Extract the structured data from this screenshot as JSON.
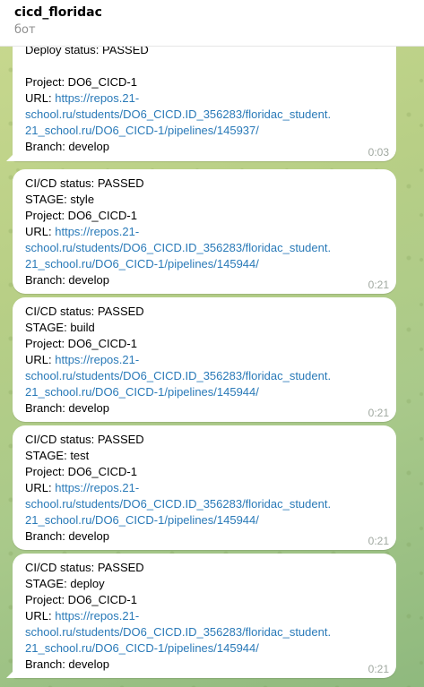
{
  "header": {
    "title": "cicd_floridac",
    "subtitle": "бот"
  },
  "messages": [
    {
      "lines": [
        "Deploy status: PASSED",
        "",
        "Project: DO6_CICD-1"
      ],
      "url_label": "URL: ",
      "url_lines": [
        "https://repos.21-",
        "school.ru/students/DO6_CICD.ID_356283/floridac_student.",
        "21_school.ru/DO6_CICD-1/pipelines/145937/"
      ],
      "branch": "Branch: develop",
      "time": "0:03"
    },
    {
      "lines": [
        "CI/CD status: PASSED",
        "STAGE: style",
        "Project: DO6_CICD-1"
      ],
      "url_label": "URL: ",
      "url_lines": [
        "https://repos.21-",
        "school.ru/students/DO6_CICD.ID_356283/floridac_student.",
        "21_school.ru/DO6_CICD-1/pipelines/145944/"
      ],
      "branch": "Branch: develop",
      "time": "0:21"
    },
    {
      "lines": [
        "CI/CD status: PASSED",
        "STAGE: build",
        "Project: DO6_CICD-1"
      ],
      "url_label": "URL: ",
      "url_lines": [
        "https://repos.21-",
        "school.ru/students/DO6_CICD.ID_356283/floridac_student.",
        "21_school.ru/DO6_CICD-1/pipelines/145944/"
      ],
      "branch": "Branch: develop",
      "time": "0:21"
    },
    {
      "lines": [
        "CI/CD status: PASSED",
        "STAGE: test",
        "Project: DO6_CICD-1"
      ],
      "url_label": "URL: ",
      "url_lines": [
        "https://repos.21-",
        "school.ru/students/DO6_CICD.ID_356283/floridac_student.",
        "21_school.ru/DO6_CICD-1/pipelines/145944/"
      ],
      "branch": "Branch: develop",
      "time": "0:21"
    },
    {
      "lines": [
        "CI/CD status: PASSED",
        "STAGE: deploy",
        "Project: DO6_CICD-1"
      ],
      "url_label": "URL: ",
      "url_lines": [
        "https://repos.21-",
        "school.ru/students/DO6_CICD.ID_356283/floridac_student.",
        "21_school.ru/DO6_CICD-1/pipelines/145944/"
      ],
      "branch": "Branch: develop",
      "time": "0:21"
    }
  ]
}
